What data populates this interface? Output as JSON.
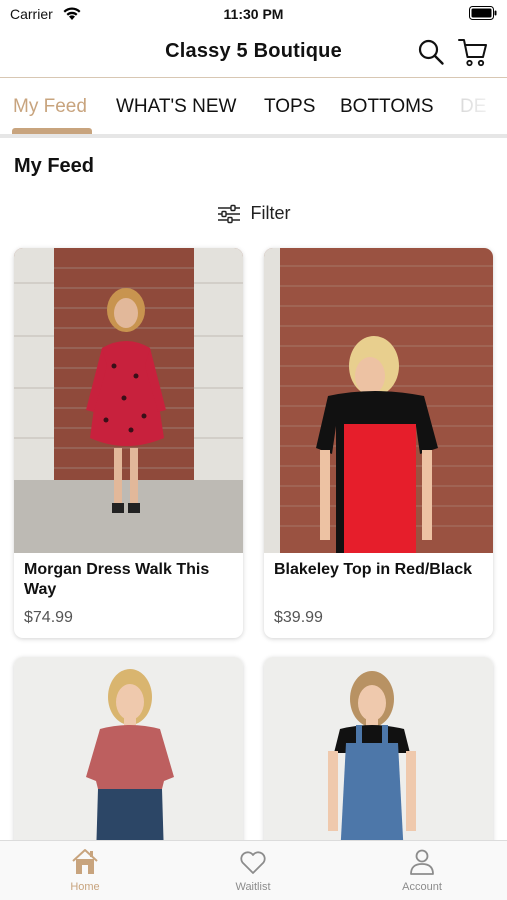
{
  "status_bar": {
    "carrier": "Carrier",
    "time": "11:30 PM"
  },
  "header": {
    "title": "Classy 5 Boutique"
  },
  "tabs": [
    {
      "label": "My Feed",
      "active": true
    },
    {
      "label": "WHAT'S NEW",
      "active": false
    },
    {
      "label": "TOPS",
      "active": false
    },
    {
      "label": "BOTTOMS",
      "active": false
    },
    {
      "label": "DE",
      "active": false
    }
  ],
  "feed": {
    "title": "My Feed",
    "filter_label": "Filter"
  },
  "products": [
    {
      "name": "Morgan Dress Walk This Way",
      "price": "$74.99"
    },
    {
      "name": "Blakeley Top in Red/Black",
      "price": "$39.99"
    },
    {
      "name": "",
      "price": ""
    },
    {
      "name": "",
      "price": ""
    }
  ],
  "bottom_tabs": [
    {
      "label": "Home",
      "icon": "home-icon",
      "active": true
    },
    {
      "label": "Waitlist",
      "icon": "heart-icon",
      "active": false
    },
    {
      "label": "Account",
      "icon": "person-icon",
      "active": false
    }
  ],
  "colors": {
    "accent": "#c8a47e",
    "divider": "#d8c7b3"
  }
}
